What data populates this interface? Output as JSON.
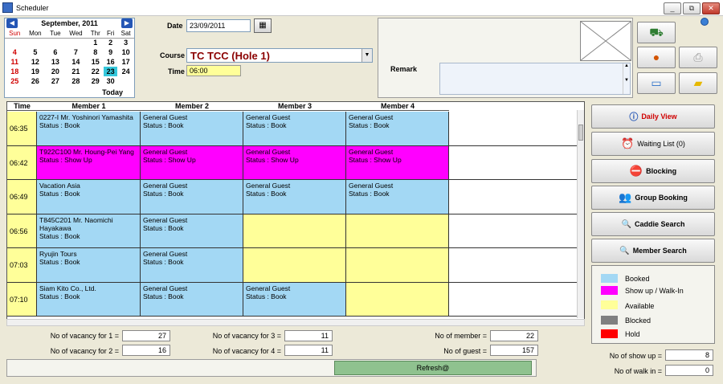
{
  "window": {
    "title": "Scheduler",
    "minimize": "_",
    "restore": "⧉",
    "close": "✕"
  },
  "calendar": {
    "month": "September, 2011",
    "prev": "◀",
    "next": "▶",
    "days": [
      "Sun",
      "Mon",
      "Tue",
      "Wed",
      "Thr",
      "Fri",
      "Sat"
    ],
    "weeks": [
      [
        "",
        "",
        "",
        "",
        "1",
        "2",
        "3"
      ],
      [
        "4",
        "5",
        "6",
        "7",
        "8",
        "9",
        "10"
      ],
      [
        "11",
        "12",
        "13",
        "14",
        "15",
        "16",
        "17"
      ],
      [
        "18",
        "19",
        "20",
        "21",
        "22",
        "23",
        "24"
      ],
      [
        "25",
        "26",
        "27",
        "28",
        "29",
        "30",
        ""
      ]
    ],
    "selected": "23",
    "today_label": "Today"
  },
  "form": {
    "date_label": "Date",
    "date_value": "23/09/2011",
    "course_label": "Course",
    "course_value": "TC TCC (Hole 1)",
    "time_label": "Time",
    "time_value": "06:00",
    "remark_label": "Remark"
  },
  "grid": {
    "headers": {
      "time": "Time",
      "m1": "Member 1",
      "m2": "Member 2",
      "m3": "Member 3",
      "m4": "Member 4"
    },
    "rows": [
      {
        "time": "06:35",
        "cells": [
          {
            "name": "0227-I Mr. Yoshinori Yamashita",
            "status": "Status : Book",
            "type": "booked"
          },
          {
            "name": "General Guest",
            "status": "Status : Book",
            "type": "booked"
          },
          {
            "name": "General Guest",
            "status": "Status : Book",
            "type": "booked"
          },
          {
            "name": "General Guest",
            "status": "Status : Book",
            "type": "booked"
          }
        ]
      },
      {
        "time": "06:42",
        "cells": [
          {
            "name": "T922C100 Mr. Houng-Pei Yang",
            "status": "Status : Show Up",
            "type": "showup"
          },
          {
            "name": "General Guest",
            "status": "Status : Show Up",
            "type": "showup"
          },
          {
            "name": "General Guest",
            "status": "Status : Show Up",
            "type": "showup"
          },
          {
            "name": "General Guest",
            "status": "Status : Show Up",
            "type": "showup"
          }
        ]
      },
      {
        "time": "06:49",
        "cells": [
          {
            "name": "Vacation Asia",
            "status": "Status : Book",
            "type": "booked"
          },
          {
            "name": "General Guest",
            "status": "Status : Book",
            "type": "booked"
          },
          {
            "name": "General Guest",
            "status": "Status : Book",
            "type": "booked"
          },
          {
            "name": "General Guest",
            "status": "Status : Book",
            "type": "booked"
          }
        ]
      },
      {
        "time": "06:56",
        "cells": [
          {
            "name": "T845C201 Mr. Naomichi Hayakawa",
            "status": "Status : Book",
            "type": "booked"
          },
          {
            "name": "General Guest",
            "status": "Status : Book",
            "type": "booked"
          },
          {
            "name": "",
            "status": "",
            "type": "available"
          },
          {
            "name": "",
            "status": "",
            "type": "available"
          }
        ]
      },
      {
        "time": "07:03",
        "cells": [
          {
            "name": "Ryujin Tours",
            "status": "Status : Book",
            "type": "booked"
          },
          {
            "name": "General Guest",
            "status": "Status : Book",
            "type": "booked"
          },
          {
            "name": "",
            "status": "",
            "type": "available"
          },
          {
            "name": "",
            "status": "",
            "type": "available"
          }
        ]
      },
      {
        "time": "07:10",
        "cells": [
          {
            "name": "Siam Kito Co., Ltd.",
            "status": "Status : Book",
            "type": "booked"
          },
          {
            "name": "General Guest",
            "status": "Status : Book",
            "type": "booked"
          },
          {
            "name": "General Guest",
            "status": "Status : Book",
            "type": "booked"
          },
          {
            "name": "",
            "status": "",
            "type": "available"
          }
        ]
      }
    ]
  },
  "buttons": {
    "daily_view": "Daily View",
    "waiting_list": "Waiting List (0)",
    "blocking": "Blocking",
    "group_booking": "Group Booking",
    "caddie_search": "Caddie Search",
    "member_search": "Member Search",
    "refresh": "Refresh@"
  },
  "legend": [
    {
      "label": "Booked",
      "color": "#a3d8f4"
    },
    {
      "label": "Show up / Walk-In",
      "color": "#ff00ff"
    },
    {
      "label": "Available",
      "color": "#ffff99"
    },
    {
      "label": "Blocked",
      "color": "#808080"
    },
    {
      "label": "Hold",
      "color": "#ff0000"
    }
  ],
  "stats": {
    "vac1_label": "No of vacancy for 1 =",
    "vac1": "27",
    "vac2_label": "No of vacancy for 2 =",
    "vac2": "16",
    "vac3_label": "No of vacancy for 3 =",
    "vac3": "11",
    "vac4_label": "No of vacancy for 4 =",
    "vac4": "11",
    "member_label": "No of member =",
    "member": "22",
    "guest_label": "No of guest =",
    "guest": "157",
    "showup_label": "No of show up =",
    "showup": "8",
    "walkin_label": "No of walk in =",
    "walkin": "0"
  },
  "colors": {
    "booked": "#a3d8f4",
    "showup": "#ff00ff",
    "available": "#ffff99",
    "time_col": "#ffff99",
    "daily_view_text": "#d00000"
  }
}
